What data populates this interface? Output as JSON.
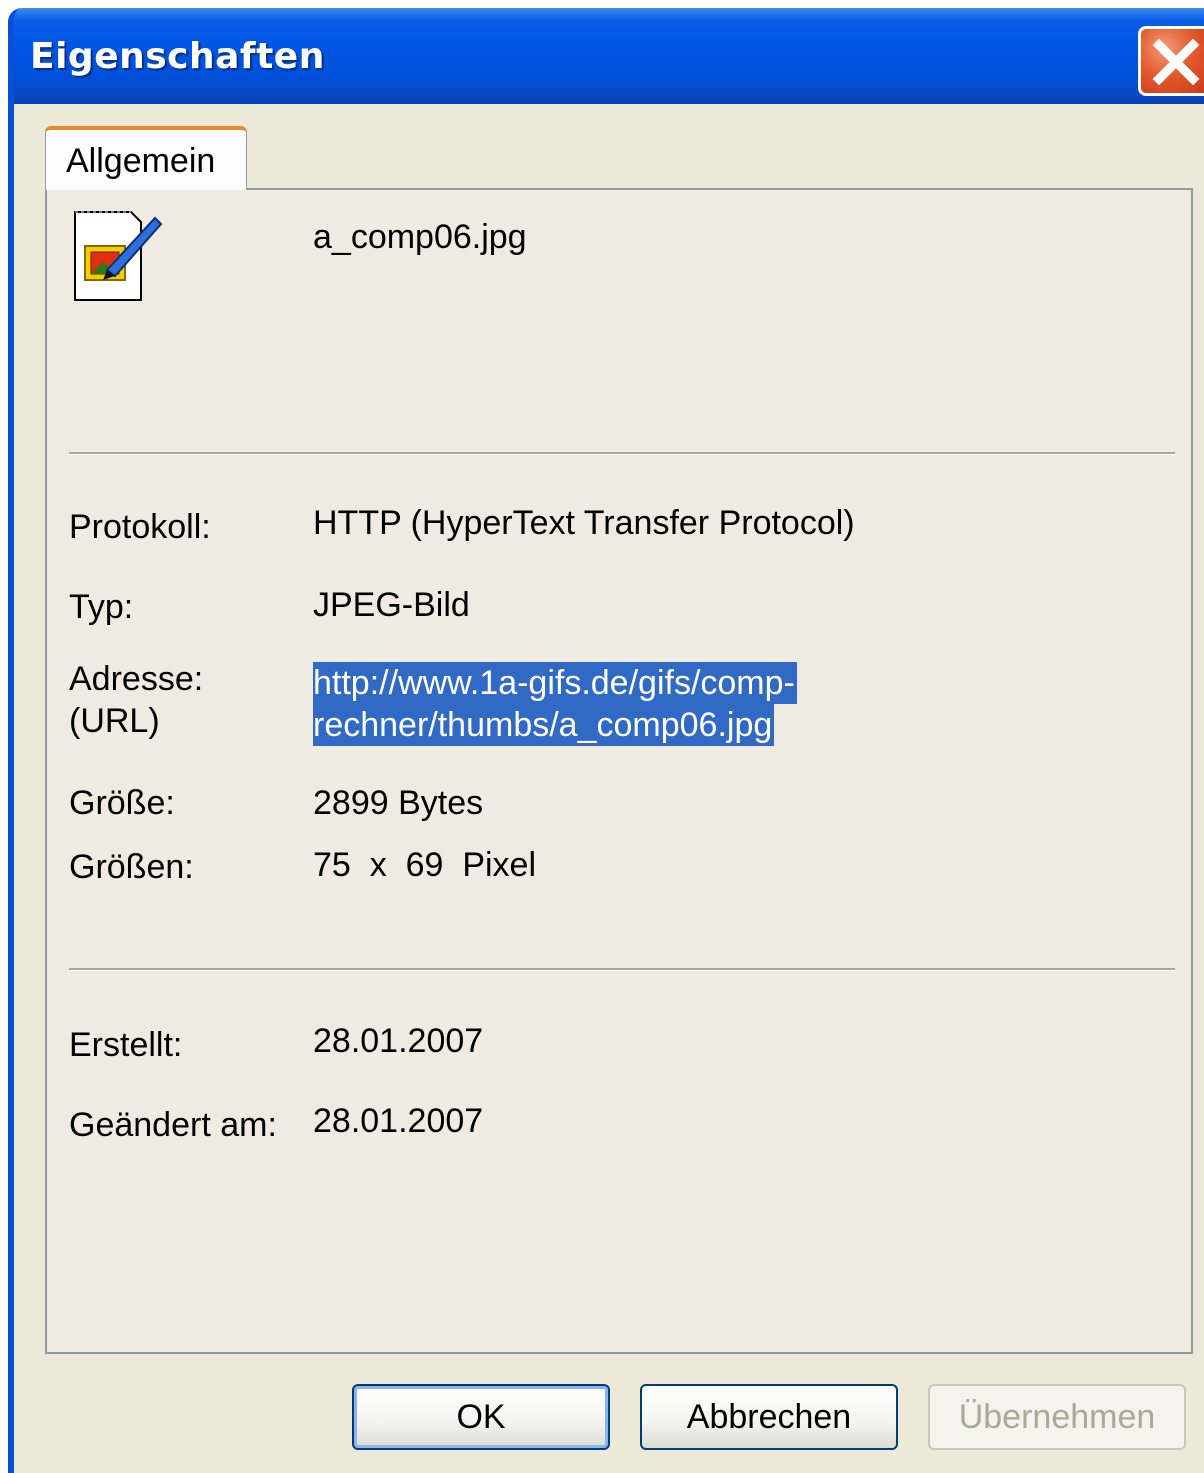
{
  "window": {
    "title": "Eigenschaften"
  },
  "tabs": [
    {
      "label": "Allgemein"
    }
  ],
  "file": {
    "name": "a_comp06.jpg"
  },
  "properties": {
    "protocol": {
      "label": "Protokoll:",
      "value": "HTTP (HyperText Transfer Protocol)"
    },
    "type": {
      "label": "Typ:",
      "value": "JPEG-Bild"
    },
    "address": {
      "label_line1": "Adresse:",
      "label_line2": "(URL)",
      "value_line1": "http://www.1a-gifs.de/gifs/comp-",
      "value_line2": "rechner/thumbs/a_comp06.jpg"
    },
    "size": {
      "label": "Größe:",
      "value": "2899 Bytes"
    },
    "dimensions": {
      "label": "Größen:",
      "value": "75  x  69  Pixel"
    },
    "created": {
      "label": "Erstellt:",
      "value": "28.01.2007"
    },
    "modified": {
      "label": "Geändert am:",
      "value": "28.01.2007"
    }
  },
  "buttons": {
    "ok": "OK",
    "cancel": "Abbrechen",
    "apply": "Übernehmen"
  },
  "icons": {
    "close": "close-icon",
    "file": "image-file-icon"
  },
  "colors": {
    "titlebar": "#0055e5",
    "selection": "#316ac5",
    "dialog_bg": "#ece9d8",
    "tab_accent": "#e68b2c"
  }
}
